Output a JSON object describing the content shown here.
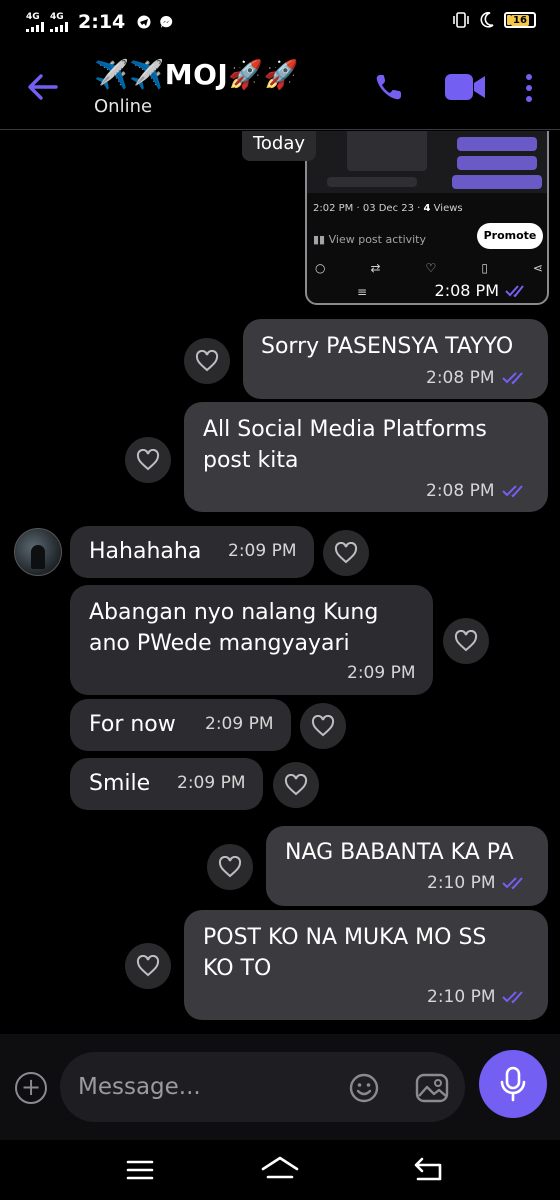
{
  "status_bar": {
    "network_1": "4G",
    "network_2": "4G",
    "time": "2:14",
    "battery": "16"
  },
  "header": {
    "contact_name": "✈️✈️MOJ🚀🚀",
    "status": "Online",
    "accent_color": "#7360f2"
  },
  "chat": {
    "date_label": "Today",
    "shared_post": {
      "meta": "2:02 PM · 03 Dec 23 · ",
      "views_count": "4",
      "views_label": " Views",
      "activity_label": "View post activity",
      "promote_label": "Promote",
      "time": "2:08 PM"
    },
    "messages": [
      {
        "direction": "out",
        "text": "Sorry PASENSYA TAYYO",
        "time": "2:08 PM"
      },
      {
        "direction": "out",
        "text": "All Social Media Platforms\npost kita",
        "time": "2:08 PM"
      },
      {
        "direction": "in",
        "text": "Hahahaha",
        "time": "2:09 PM"
      },
      {
        "direction": "in",
        "text": "Abangan nyo nalang Kung\nano PWede mangyayari",
        "time": "2:09 PM"
      },
      {
        "direction": "in",
        "text": "For now",
        "time": "2:09 PM"
      },
      {
        "direction": "in",
        "text": "Smile",
        "time": "2:09 PM"
      },
      {
        "direction": "out",
        "text": "NAG BABANTA KA PA",
        "time": "2:10 PM"
      },
      {
        "direction": "out",
        "text": "POST KO NA MUKA MO SS\nKO TO",
        "time": "2:10 PM"
      }
    ]
  },
  "composer": {
    "placeholder": "Message..."
  }
}
